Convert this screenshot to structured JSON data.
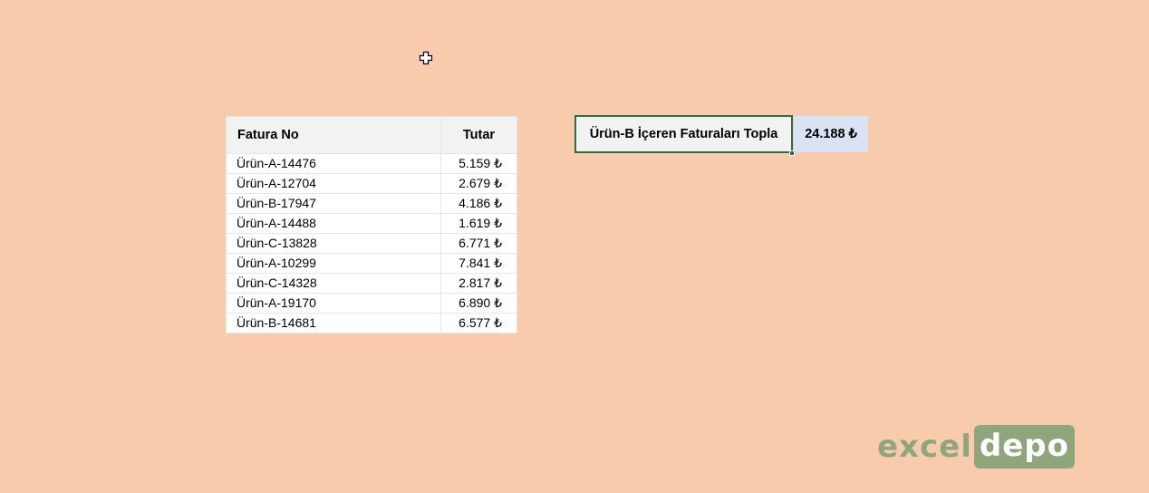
{
  "table": {
    "headers": [
      "Fatura No",
      "Tutar"
    ],
    "rows": [
      [
        "Ürün-A-14476",
        "5.159 ₺"
      ],
      [
        "Ürün-A-12704",
        "2.679 ₺"
      ],
      [
        "Ürün-B-17947",
        "4.186 ₺"
      ],
      [
        "Ürün-A-14488",
        "1.619 ₺"
      ],
      [
        "Ürün-C-13828",
        "6.771 ₺"
      ],
      [
        "Ürün-A-10299",
        "7.841 ₺"
      ],
      [
        "Ürün-C-14328",
        "2.817 ₺"
      ],
      [
        "Ürün-A-19170",
        "6.890 ₺"
      ],
      [
        "Ürün-B-14681",
        "6.577 ₺"
      ]
    ]
  },
  "summary": {
    "label": "Ürün-B İçeren Faturaları Topla",
    "value": "24.188 ₺"
  },
  "logo": {
    "part1": "excel",
    "part2": "depo"
  },
  "cursor": {
    "icon": "cell-select-cross-icon"
  },
  "colors": {
    "background": "#f8cbad",
    "header_bg": "#f2f2f2",
    "selection_border": "#2e6e47",
    "result_bg": "#dae3f3",
    "logo_green": "#8fa67c"
  }
}
